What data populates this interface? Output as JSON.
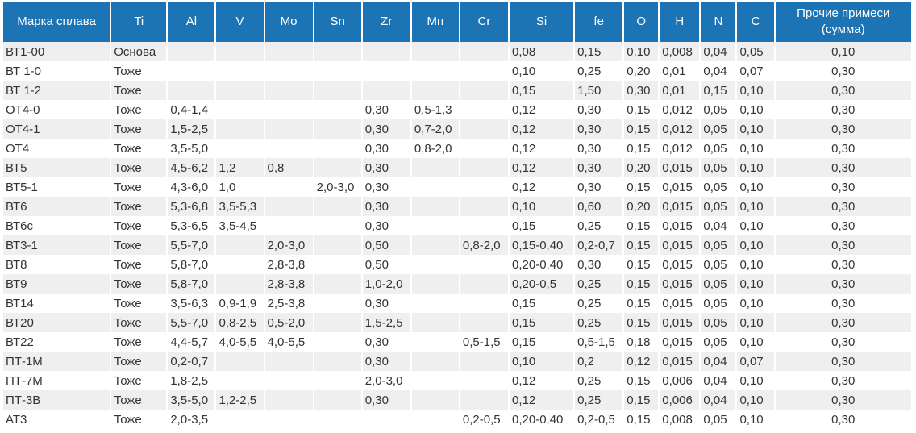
{
  "headers": [
    "Марка сплава",
    "Ti",
    "Al",
    "V",
    "Mo",
    "Sn",
    "Zr",
    "Mп",
    "Cr",
    "Si",
    "fe",
    "O",
    "H",
    "N",
    "C",
    "Прочие примеси (сумма)"
  ],
  "rows": [
    [
      "ВТ1-00",
      "Основа",
      "",
      "",
      "",
      "",
      "",
      "",
      "",
      "0,08",
      "0,15",
      "0,10",
      "0,008",
      "0,04",
      "0,05",
      "0,10"
    ],
    [
      "ВТ 1-0",
      "Тоже",
      "",
      "",
      "",
      "",
      "",
      "",
      "",
      "0,10",
      "0,25",
      "0,20",
      "0,01",
      "0,04",
      "0,07",
      "0,30"
    ],
    [
      "ВТ 1-2",
      "Тоже",
      "",
      "",
      "",
      "",
      "",
      "",
      "",
      "0,15",
      "1,50",
      "0,30",
      "0,01",
      "0,15",
      "0,10",
      "0,30"
    ],
    [
      "ОТ4-0",
      "Тоже",
      "0,4-1,4",
      "",
      "",
      "",
      "0,30",
      "0,5-1,3",
      "",
      "0,12",
      "0,30",
      "0,15",
      "0,012",
      "0,05",
      "0,10",
      "0,30"
    ],
    [
      "ОТ4-1",
      "Тоже",
      "1,5-2,5",
      "",
      "",
      "",
      "0,30",
      "0,7-2,0",
      "",
      "0,12",
      "0,30",
      "0,15",
      "0,012",
      "0,05",
      "0,10",
      "0,30"
    ],
    [
      "ОТ4",
      "Тоже",
      "3,5-5,0",
      "",
      "",
      "",
      "0,30",
      "0,8-2,0",
      "",
      "0,12",
      "0,30",
      "0,15",
      "0,012",
      "0,05",
      "0,10",
      "0,30"
    ],
    [
      "ВТ5",
      "Тоже",
      "4,5-6,2",
      "1,2",
      "0,8",
      "",
      "0,30",
      "",
      "",
      "0,12",
      "0,30",
      "0,20",
      "0,015",
      "0,05",
      "0,10",
      "0,30"
    ],
    [
      "ВТ5-1",
      "Тоже",
      "4,3-6,0",
      "1,0",
      "",
      "2,0-3,0",
      "0,30",
      "",
      "",
      "0,12",
      "0,30",
      "0,15",
      "0,015",
      "0,05",
      "0,10",
      "0,30"
    ],
    [
      "ВТ6",
      "Тоже",
      "5,3-6,8",
      "3,5-5,3",
      "",
      "",
      "0,30",
      "",
      "",
      "0,10",
      "0,60",
      "0,20",
      "0,015",
      "0,05",
      "0,10",
      "0,30"
    ],
    [
      "ВТ6с",
      "Тоже",
      "5,3-6,5",
      "3,5-4,5",
      "",
      "",
      "0,30",
      "",
      "",
      "0,15",
      "0,25",
      "0,15",
      "0,015",
      "0,04",
      "0,10",
      "0,30"
    ],
    [
      "ВТ3-1",
      "Тоже",
      "5,5-7,0",
      "",
      "2,0-3,0",
      "",
      "0,50",
      "",
      "0,8-2,0",
      "0,15-0,40",
      "0,2-0,7",
      "0,15",
      "0,015",
      "0,05",
      "0,10",
      "0,30"
    ],
    [
      "ВТ8",
      "Тоже",
      "5,8-7,0",
      "",
      "2,8-3,8",
      "",
      "0,50",
      "",
      "",
      "0,20-0,40",
      "0,30",
      "0,15",
      "0,015",
      "0,05",
      "0,10",
      "0,30"
    ],
    [
      "ВТ9",
      "Тоже",
      "5,8-7,0",
      "",
      "2,8-3,8",
      "",
      "1,0-2,0",
      "",
      "",
      "0,20-0,5",
      "0,25",
      "0,15",
      "0,015",
      "0,05",
      "0,10",
      "0,30"
    ],
    [
      "ВТ14",
      "Тоже",
      "3,5-6,3",
      "0,9-1,9",
      "2,5-3,8",
      "",
      "0,30",
      "",
      "",
      "0,15",
      "0,25",
      "0,15",
      "0,015",
      "0,05",
      "0,10",
      "0,30"
    ],
    [
      "ВТ20",
      "Тоже",
      "5,5-7,0",
      "0,8-2,5",
      "0,5-2,0",
      "",
      "1,5-2,5",
      "",
      "",
      "0,15",
      "0,25",
      "0,15",
      "0,015",
      "0,05",
      "0,10",
      "0,30"
    ],
    [
      "ВТ22",
      "Тоже",
      "4,4-5,7",
      "4,0-5,5",
      "4,0-5,5",
      "",
      "0,30",
      "",
      "0,5-1,5",
      "0,15",
      "0,5-1,5",
      "0,18",
      "0,015",
      "0,05",
      "0,10",
      "0,30"
    ],
    [
      "ПТ-1М",
      "Тоже",
      "0,2-0,7",
      "",
      "",
      "",
      "0,30",
      "",
      "",
      "0,10",
      "0,2",
      "0,12",
      "0,015",
      "0,04",
      "0,07",
      "0,30"
    ],
    [
      "ПТ-7М",
      "Тоже",
      "1,8-2,5",
      "",
      "",
      "",
      "2,0-3,0",
      "",
      "",
      "0,12",
      "0,25",
      "0,15",
      "0,006",
      "0,04",
      "0,10",
      "0,30"
    ],
    [
      "ПТ-3В",
      "Тоже",
      "3,5-5,0",
      "1,2-2,5",
      "",
      "",
      "0,30",
      "",
      "",
      "0,12",
      "0,25",
      "0,15",
      "0,006",
      "0,04",
      "0,10",
      "0,30"
    ],
    [
      "АТ3",
      "Тоже",
      "2,0-3,5",
      "",
      "",
      "",
      "",
      "",
      "0,2-0,5",
      "0,20-0,40",
      "0,2-0,5",
      "0,15",
      "0,008",
      "0,05",
      "0,10",
      "0,30"
    ]
  ]
}
